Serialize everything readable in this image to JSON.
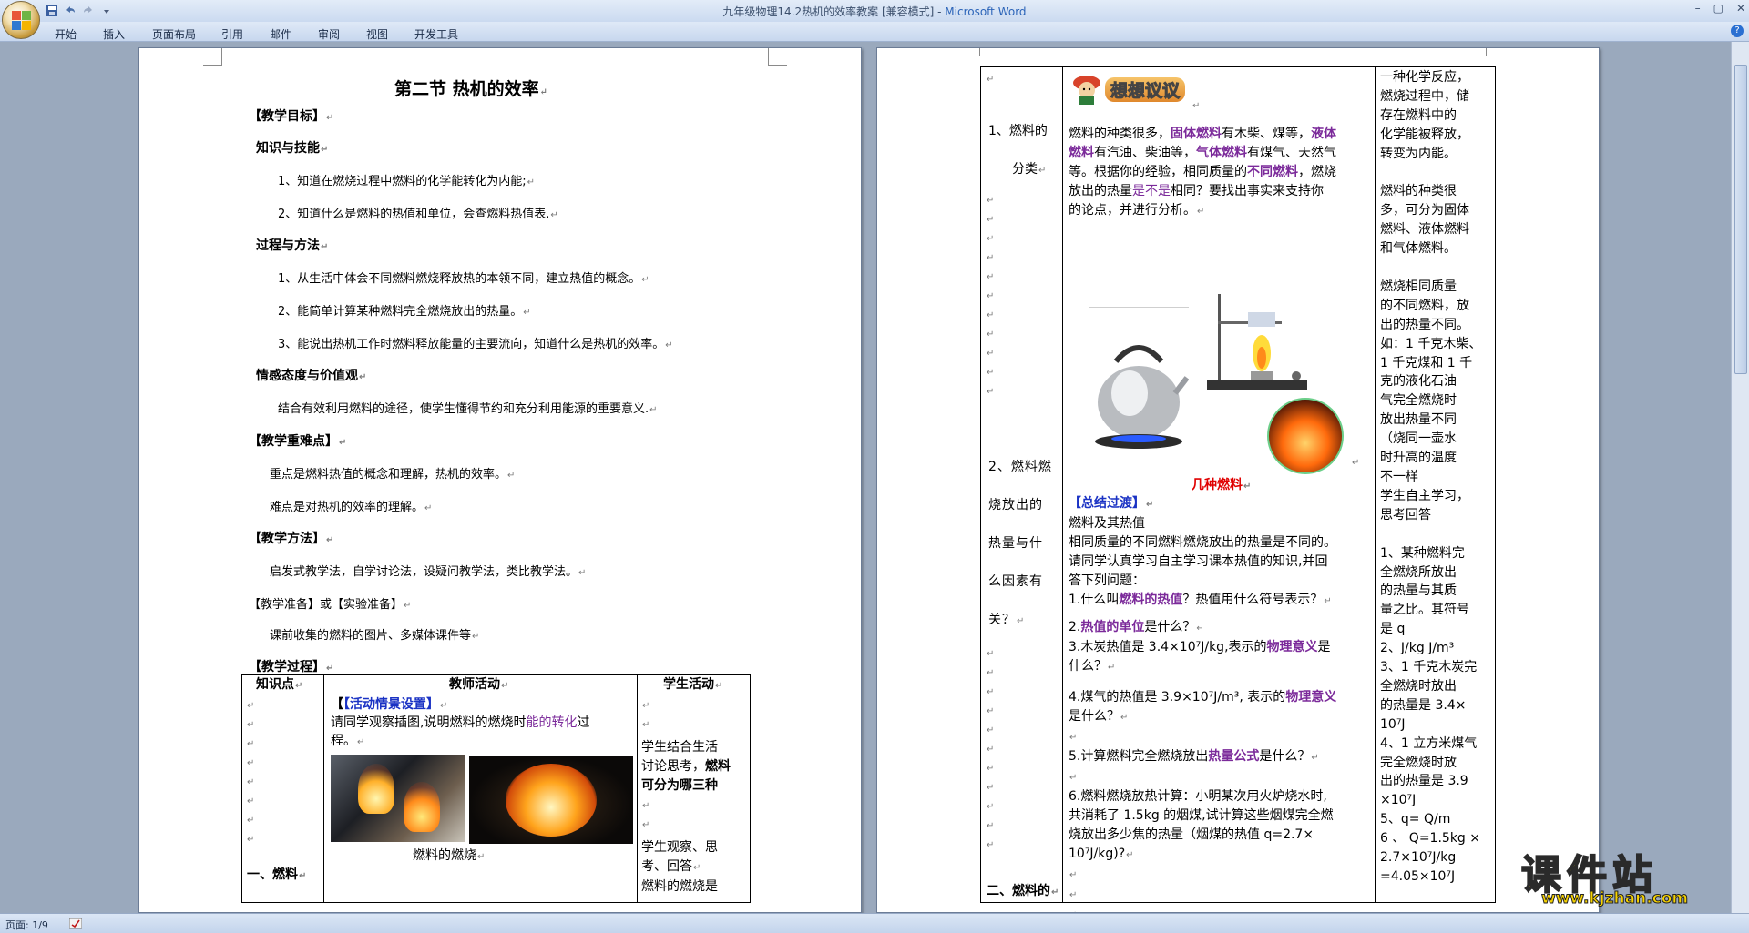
{
  "window": {
    "title_doc": "九年级物理14.2热机的效率教案 [兼容模式] - ",
    "title_app": "Microsoft Word",
    "minimize": "–",
    "maximize": "▢",
    "close": "✕",
    "help": "?"
  },
  "menu": [
    "开始",
    "插入",
    "页面布局",
    "引用",
    "邮件",
    "审阅",
    "视图",
    "开发工具"
  ],
  "status": {
    "page": "页面: 1/9"
  },
  "watermark": {
    "big": "课件站",
    "url": "www.kjzhan.com"
  },
  "page1": {
    "title": "第二节      热机的效率",
    "goal_h": "【教学目标】",
    "k_h": "知识与技能",
    "k1": "1、知道在燃烧过程中燃料的化学能转化为内能;",
    "k2": "2、知道什么是燃料的热值和单位，会查燃料热值表.",
    "p_h": "过程与方法",
    "p1": "1、从生活中体会不同燃料燃烧释放热的本领不同，建立热值的概念。",
    "p2": "2、能简单计算某种燃料完全燃烧放出的热量。",
    "p3": "3、能说出热机工作时燃料释放能量的主要流向，知道什么是热机的效率。",
    "e_h": "情感态度与价值观",
    "e1": "结合有效利用燃料的途径，使学生懂得节约和充分利用能源的重要意义.",
    "d_h": "【教学重难点】",
    "d1": "重点是燃料热值的概念和理解，热机的效率。",
    "d2": "难点是对热机的效率的理解。",
    "m_h": "【教学方法】",
    "m1": "启发式教学法，自学讨论法，设疑问教学法，类比教学法。",
    "r_h": "【教学准备】或【实验准备】",
    "r1": "课前收集的燃料的图片、多媒体课件等",
    "proc_h": "【教学过程】",
    "table": {
      "h1": "知识点",
      "h2": "教师活动",
      "h3": "学生活动",
      "c1_bottom": "一、燃料",
      "t_act": "【活动情景设置】",
      "t_line1a": "请同学观察插图,说明燃料的燃烧时",
      "t_line1b": "能的转化",
      "t_line1c": "过",
      "t_line2": "程。",
      "caption": "燃料的燃烧",
      "s1": "学生结合生活",
      "s2": "讨论思考，",
      "s2b": "燃料",
      "s3": "可分为哪三种",
      "s4": "学生观察、思",
      "s5": "考、回答",
      "s6": "燃料的燃烧是"
    }
  },
  "page2": {
    "col1": {
      "a1": "1、燃料的",
      "a2": "分类",
      "b1": "2、燃料燃",
      "b2": "烧放出的",
      "b3": "热量与什",
      "b4": "么因素有",
      "b5": "关？",
      "c1": "二、燃料的"
    },
    "banner": "想想议议",
    "mid": {
      "l1a": "燃料的种类很多，",
      "l1b": "固体燃料",
      "l1c": "有木柴、煤等，",
      "l1d": "液体",
      "l2a": "燃料",
      "l2b": "有汽油、柴油等，",
      "l2c": "气体燃料",
      "l2d": "有煤气、天然气",
      "l3a": "等。根据你的经验，相同质量的",
      "l3b": "不同燃料",
      "l3c": "，燃烧",
      "l4a": "放出的热量",
      "l4b": "是不是",
      "l4c": "相同？要找出事实来支持你",
      "l5": "的论点，并进行分析。",
      "fig": "几种燃料",
      "sum": "【总结过渡】",
      "q0": "燃料及其热值",
      "q1": "相同质量的不同燃料燃烧放出的热量是不同的。",
      "q2": "请同学认真学习自主学习课本热值的知识,并回",
      "q3": "答下列问题：",
      "q4a": "1.什么叫",
      "q4b": "燃料的热值",
      "q4c": "？热值用什么符号表示？",
      "q5a": "2.",
      "q5b": "热值的单位",
      "q5c": "是什么？",
      "q6a": "3.木炭热值是 3.4×10⁷J/kg,表示的",
      "q6b": "物理意义",
      "q6c": "是",
      "q7": "什么？",
      "q8a": "4.煤气的热值是 3.9×10⁷J/m³, 表示的",
      "q8b": "物理意义",
      "q9": "是什么？",
      "q10a": "5.计算燃料完全燃烧放出",
      "q10b": "热量公式",
      "q10c": "是什么？",
      "q11": "6.燃料燃烧放热计算：小明某次用火炉烧水时,",
      "q12": "共消耗了 1.5kg 的烟煤,试计算这些烟煤完全燃",
      "q13": "烧放出多少焦的热量（烟煤的热值 q=2.7×",
      "q14": "10⁷J/kg)?"
    },
    "right": [
      "一种化学反应，",
      "燃烧过程中，储",
      "存在燃料中的",
      "化学能被释放，",
      "转变为内能。",
      "",
      "燃料的种类很",
      "多，可分为固体",
      "燃料、液体燃料",
      "和气体燃料。",
      "",
      "燃烧相同质量",
      "的不同燃料，放",
      "出的热量不同。",
      "如：1 千克木柴、",
      "1 千克煤和 1 千",
      "克的液化石油",
      "气完全燃烧时",
      "放出热量不同",
      "（烧同一壶水",
      "时升高的温度",
      "不一样",
      "学生自主学习，",
      "思考回答",
      "",
      "1、某种燃料完",
      "全燃烧所放出",
      "的热量与其质",
      "量之比。其符号",
      "是 q",
      "2、J/kg    J/m³",
      "3、1 千克木炭完",
      "全燃烧时放出",
      "的热量是 3.4×",
      "10⁷J",
      "4、1 立方米煤气",
      "完全燃烧时放",
      "出的热量是 3.9",
      "×10⁷J",
      "5、q= Q/m",
      "6 、 Q=1.5kg ×",
      "2.7×10⁷J/kg",
      " =4.05×10⁷J"
    ]
  }
}
